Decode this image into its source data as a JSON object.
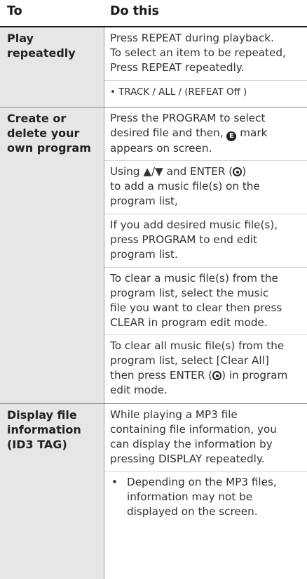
{
  "header": {
    "col1": "To",
    "col2": "Do this"
  },
  "rows": [
    {
      "label": [
        "Play",
        "repeatedly"
      ],
      "paras": [
        [
          "Press REPEAT during playback.",
          "To select an item to be repeated,",
          "Press REPEAT repeatedly."
        ],
        [
          "• TRACK / ALL / (REFEAT Off )"
        ]
      ]
    },
    {
      "label": [
        "Create or",
        "delete your",
        "own program"
      ],
      "p1": [
        "Press the PROGRAM to select",
        "desired file and then, ",
        " mark",
        "appears on screen."
      ],
      "e_glyph": "E",
      "p2": [
        "Using ",
        "▲/▼",
        " and ENTER (",
        ")",
        "to add a music file(s) on the",
        "program list,"
      ],
      "p3": [
        "If you add desired music file(s),",
        "press PROGRAM to end edit",
        "program list."
      ],
      "p4": [
        "To clear a music file(s) from the",
        "program list, select the music",
        "file you want to clear then press",
        "CLEAR in program edit mode."
      ],
      "p5": [
        "To clear all music file(s) from the",
        "program list, select [Clear All]",
        "then press ENTER (",
        ") in program",
        "edit mode."
      ]
    },
    {
      "label": [
        "Display file",
        "information",
        "(ID3 TAG)"
      ],
      "paras": [
        [
          "While playing a MP3 file",
          "containing file information, you",
          "can display the information by",
          "pressing DISPLAY repeatedly."
        ]
      ],
      "bullet": {
        "mark": "•",
        "lines": [
          "Depending on the MP3 files,",
          "information may not be",
          "displayed on the screen."
        ]
      }
    }
  ]
}
